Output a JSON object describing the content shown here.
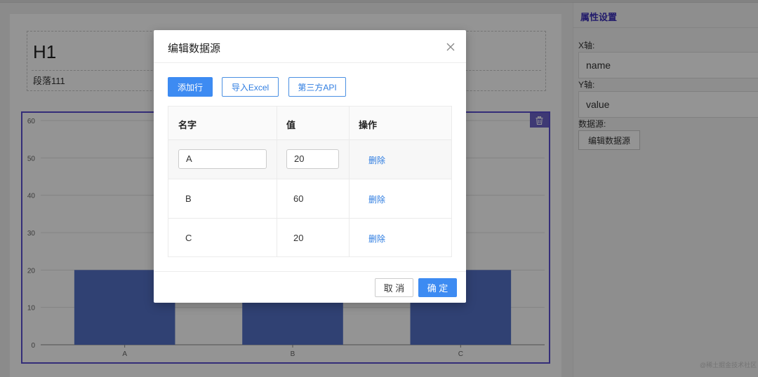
{
  "editor": {
    "heading": "H1",
    "paragraph": "段落111"
  },
  "chart_data": {
    "type": "bar",
    "categories": [
      "A",
      "B",
      "C"
    ],
    "values": [
      20,
      60,
      20
    ],
    "ylim": [
      0,
      60
    ],
    "yticks": [
      0,
      10,
      20,
      30,
      40,
      50,
      60
    ],
    "grid": true,
    "bar_color": "#5470c6"
  },
  "side_panel": {
    "title": "属性设置",
    "x_axis_label": "X轴:",
    "x_axis_value": "name",
    "y_axis_label": "Y轴:",
    "y_axis_value": "value",
    "datasource_label": "数据源:",
    "edit_datasource_button": "编辑数据源"
  },
  "modal": {
    "title": "编辑数据源",
    "toolbar": {
      "add_row": "添加行",
      "import_excel": "导入Excel",
      "third_party_api": "第三方API"
    },
    "table": {
      "headers": [
        "名字",
        "值",
        "操作"
      ],
      "rows": [
        {
          "name": "A",
          "value": "20",
          "action": "删除"
        },
        {
          "name": "B",
          "value": "60",
          "action": "删除"
        },
        {
          "name": "C",
          "value": "20",
          "action": "删除"
        }
      ]
    },
    "footer": {
      "cancel": "取 消",
      "confirm": "确 定"
    }
  },
  "watermark": "@稀土掘金技术社区",
  "colors": {
    "primary": "#3d8bf2",
    "selection_border": "#5b4fcf",
    "link": "#2f7de1"
  }
}
